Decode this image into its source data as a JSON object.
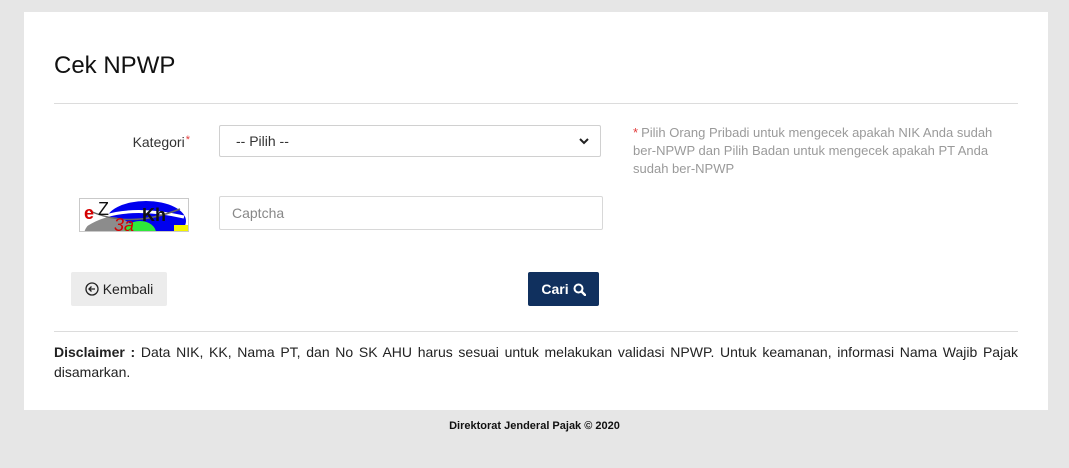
{
  "page": {
    "title": "Cek NPWP"
  },
  "form": {
    "kategori_label": "Kategori",
    "required_mark": "*",
    "kategori_selected": "-- Pilih --",
    "hint_star": "*",
    "hint_text": "Pilih Orang Pribadi untuk mengecek apakah NIK Anda sudah ber-NPWP dan Pilih Badan untuk mengecek apakah PT Anda sudah ber-NPWP",
    "captcha_text": "eZ3aKh",
    "captcha_placeholder": "Captcha"
  },
  "buttons": {
    "back_label": "Kembali",
    "search_label": "Cari"
  },
  "disclaimer": {
    "label": "Disclaimer :",
    "text": " Data NIK, KK, Nama PT, dan No SK AHU harus sesuai untuk melakukan validasi NPWP. Untuk keamanan, informasi Nama Wajib Pajak disamarkan."
  },
  "footer": {
    "text": "Direktorat Jenderal Pajak © 2020"
  },
  "colors": {
    "primary_button": "#10305e",
    "required": "#e23b3b",
    "hint_text": "#9a9a9a",
    "background": "#e6e6e6"
  },
  "icons": {
    "back": "arrow-left-circle-icon",
    "search": "search-icon",
    "select": "chevron-down-icon"
  }
}
